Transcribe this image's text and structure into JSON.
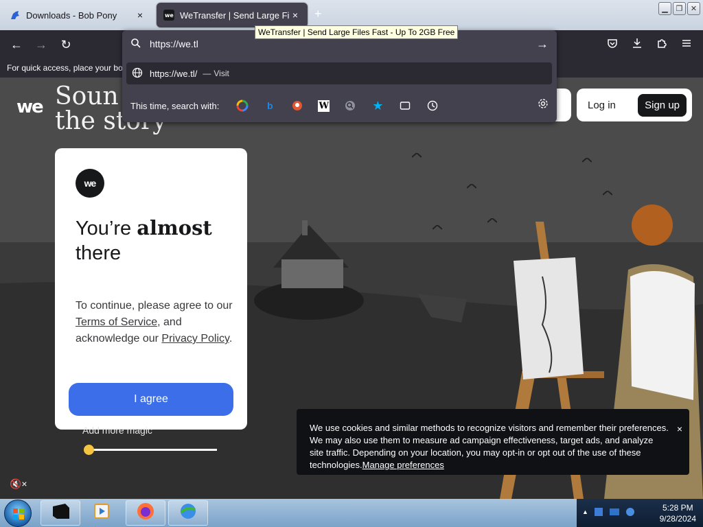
{
  "tabs": [
    {
      "title": "Downloads - Bob Pony",
      "close": "×",
      "favicon": "pony-icon"
    },
    {
      "title": "WeTransfer | Send Large Files F",
      "close": "×",
      "favicon": "wetransfer-icon"
    }
  ],
  "new_tab": "+",
  "window_buttons": [
    "minimize",
    "maximize",
    "close"
  ],
  "tooltip": "WeTransfer | Send Large Files Fast - Up To 2GB Free",
  "nav": {
    "back": "←",
    "forward": "→",
    "reload": "↻"
  },
  "bookmarks_hint": "For quick access, place your boo",
  "urlbar": {
    "value": "https://we.tl",
    "go": "→",
    "suggestion_url": "https://we.tl/",
    "suggestion_sep": "—",
    "suggestion_action": "Visit",
    "search_with_label": "This time, search with:",
    "engines": [
      "google-icon",
      "bing-icon",
      "duckduckgo-icon",
      "wikipedia-icon",
      "search-icon",
      "bookmarks-star-icon",
      "tabs-icon",
      "history-icon"
    ]
  },
  "toolbar_icons": [
    "pocket-icon",
    "download-icon",
    "extensions-icon",
    "menu-icon"
  ],
  "page": {
    "logo": "we",
    "headline_line1": "Soun",
    "headline_line2": "the story",
    "login": "Log in",
    "signup": "Sign up",
    "consent": {
      "logo": "we",
      "title_pre": "You’re ",
      "title_bold": "almost",
      "title_post": "there",
      "body_pre": "To continue, please agree to our ",
      "terms": "Terms of Service",
      "body_mid": ", and acknowledge our ",
      "privacy": "Privacy Policy",
      "body_end": ".",
      "agree": "I agree"
    },
    "magic": "Add more magic",
    "mute": "🔇×",
    "cookie": {
      "text": "We use cookies and similar methods to recognize visitors and remember their preferences. We may also use them to measure ad campaign effectiveness, target ads, and analyze site traffic. Depending on your location, you may opt-in or opt out of the use of these technologies.",
      "manage": "Manage preferences",
      "close": "×"
    }
  },
  "taskbar": {
    "time": "5:28 PM",
    "date": "9/28/2024",
    "tray_arrow": "▲"
  }
}
